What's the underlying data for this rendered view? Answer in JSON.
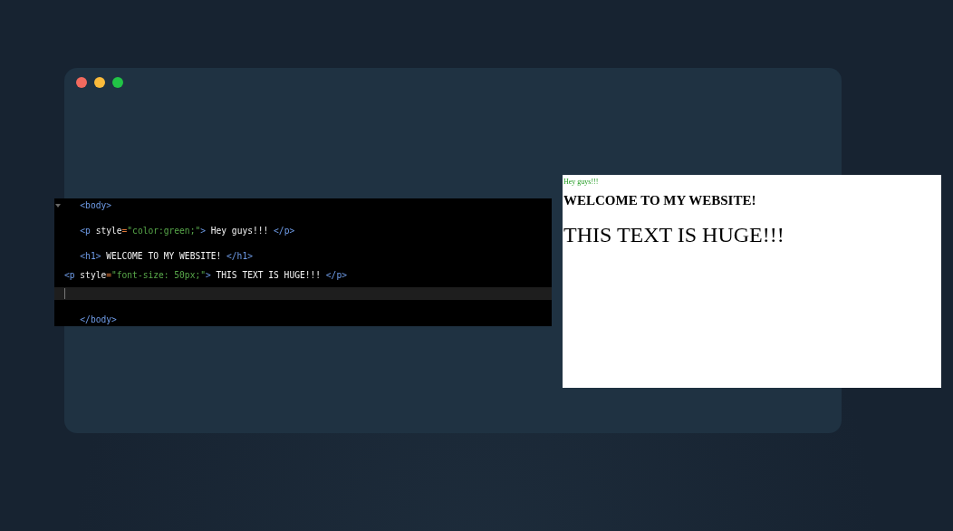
{
  "window": {
    "dots": [
      {
        "color": "#f26a5e"
      },
      {
        "color": "#fbbb3b"
      },
      {
        "color": "#21c346"
      }
    ]
  },
  "code_editor": {
    "lines": [
      {
        "current": false,
        "tokens": [
          {
            "kind": "tag",
            "text": "   <body>"
          }
        ]
      },
      {
        "current": false,
        "tokens": [
          {
            "kind": "tag",
            "text": "   <p "
          },
          {
            "kind": "attr",
            "text": "style"
          },
          {
            "kind": "punct",
            "text": "="
          },
          {
            "kind": "string",
            "text": "\"color:green;\""
          },
          {
            "kind": "tag",
            "text": ">"
          },
          {
            "kind": "text",
            "text": " Hey guys!!! "
          },
          {
            "kind": "tag",
            "text": "</p>"
          }
        ]
      },
      {
        "current": false,
        "tokens": [
          {
            "kind": "tag",
            "text": "   <h1>"
          },
          {
            "kind": "text",
            "text": " WELCOME TO MY WEBSITE! "
          },
          {
            "kind": "tag",
            "text": "</h1>"
          }
        ]
      },
      {
        "current": false,
        "tokens": [
          {
            "kind": "tag",
            "text": "<p "
          },
          {
            "kind": "attr",
            "text": "style"
          },
          {
            "kind": "punct",
            "text": "="
          },
          {
            "kind": "string",
            "text": "\"font-size: 50px;\""
          },
          {
            "kind": "tag",
            "text": ">"
          },
          {
            "kind": "text",
            "text": " THIS TEXT IS HUGE!!! "
          },
          {
            "kind": "tag",
            "text": "</p>"
          }
        ]
      },
      {
        "current": true
      },
      {
        "current": false,
        "tokens": [
          {
            "kind": "tag",
            "text": "   </body>"
          }
        ]
      }
    ]
  },
  "browser_preview": {
    "items": [
      {
        "kind": "p",
        "text": "Hey guys!!!"
      },
      {
        "kind": "h1",
        "text": "WELCOME TO MY WEBSITE!"
      },
      {
        "kind": "huge",
        "text": "THIS TEXT IS HUGE!!!"
      }
    ]
  }
}
